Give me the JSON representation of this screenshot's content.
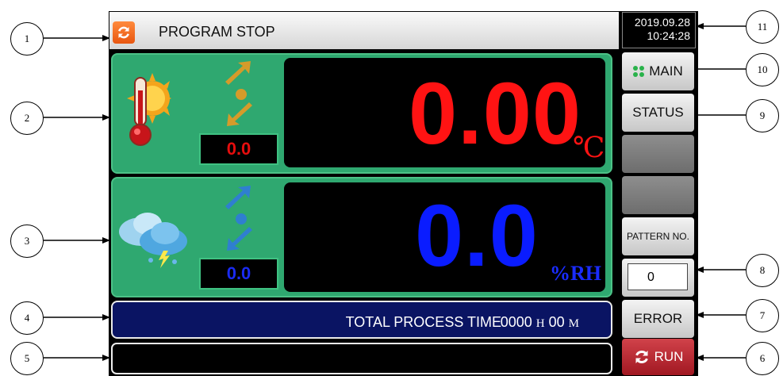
{
  "header": {
    "title": "PROGRAM STOP",
    "date": "2019.09.28",
    "time": "10:24:28"
  },
  "temperature": {
    "value": "0.00",
    "unit": "℃",
    "setpoint": "0.0",
    "color": "#ff1313"
  },
  "humidity": {
    "value": "0.0",
    "unit": "%RH",
    "setpoint": "0.0",
    "color": "#0a1cff"
  },
  "process_time": {
    "label": "TOTAL PROCESS TIME",
    "hours": "0000",
    "hours_unit": "H",
    "minutes": "00",
    "minutes_unit": "M"
  },
  "sidebar": {
    "main_label": "MAIN",
    "status_label": "STATUS",
    "pattern_label": "PATTERN NO.",
    "pattern_value": "0",
    "error_label": "ERROR",
    "run_label": "RUN"
  },
  "callouts": [
    "1",
    "2",
    "3",
    "4",
    "5",
    "6",
    "7",
    "8",
    "9",
    "10",
    "11"
  ],
  "icons": {
    "sync": "sync-icon",
    "thermometer_sun": "thermometer-sun-icon",
    "cloud_rain": "cloud-rain-icon",
    "temp_ramp": "ramp-arrows-icon",
    "hum_ramp": "ramp-arrows-icon",
    "main_dots": "grid-dots-icon",
    "run": "refresh-icon"
  },
  "colors": {
    "panel_green": "#2fa870",
    "time_bar_navy": "#0a1463",
    "run_red": "#b52730",
    "accent_orange": "#f06a1f"
  }
}
